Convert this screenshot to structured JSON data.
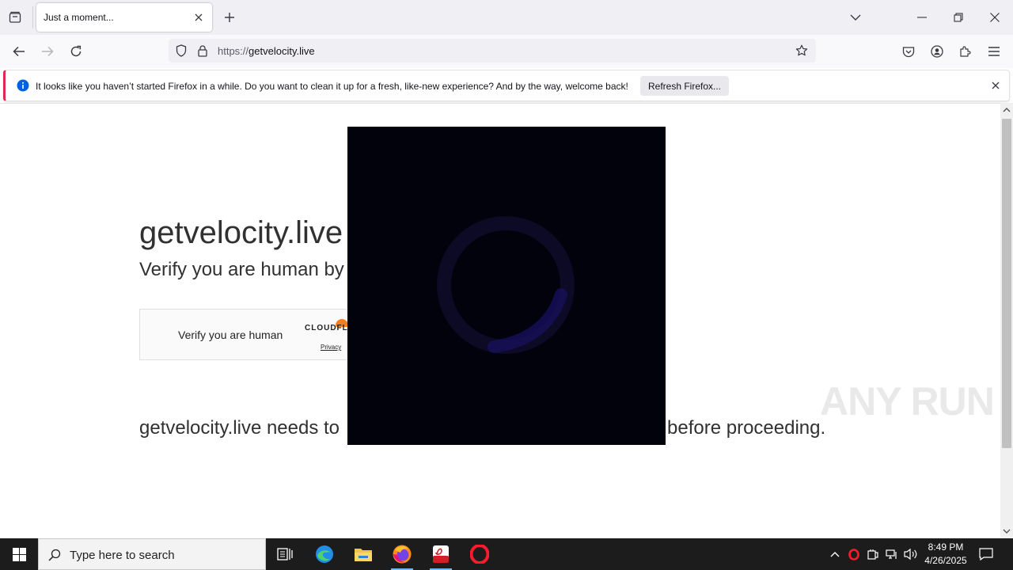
{
  "browser": {
    "tab_title": "Just a moment...",
    "url_scheme": "https://",
    "url_host": "getvelocity.live"
  },
  "notification": {
    "text": "It looks like you haven’t started Firefox in a while. Do you want to clean it up for a fresh, like-new experience? And by the way, welcome back!",
    "button_label": "Refresh Firefox..."
  },
  "page": {
    "title": "getvelocity.live",
    "subtitle": "Verify you are human by",
    "widget_label": "Verify you are human",
    "widget_brand": "CLOUDFL",
    "widget_privacy": "Privacy",
    "body_left": "getvelocity.live needs to",
    "body_right": "n before proceeding."
  },
  "watermark": "ANY RUN",
  "taskbar": {
    "search_placeholder": "Type here to search",
    "time": "8:49 PM",
    "date": "4/26/2025"
  },
  "colors": {
    "notification_accent": "#e22850",
    "overlay": "#02020d",
    "taskbar": "#1c1c1c"
  }
}
